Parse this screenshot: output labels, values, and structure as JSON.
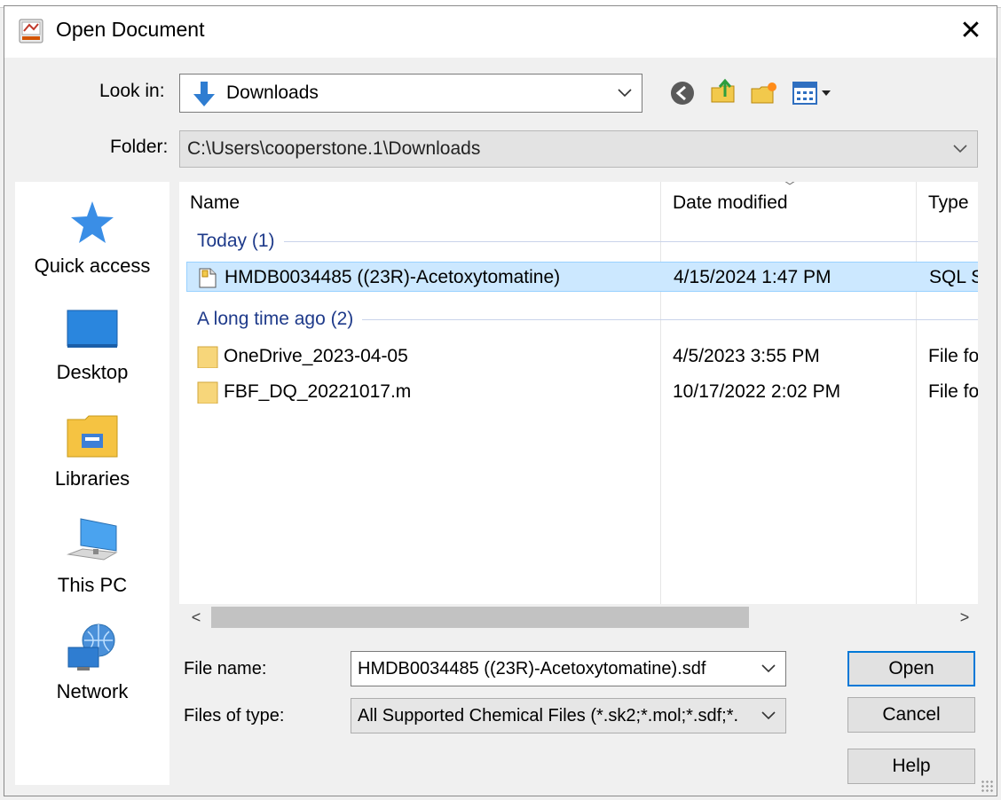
{
  "window": {
    "title": "Open Document",
    "close_glyph": "✕"
  },
  "look_in": {
    "label": "Look in:",
    "value": "Downloads",
    "icon": "download-arrow-icon"
  },
  "toolbar": {
    "icons": [
      "back-icon",
      "up-folder-icon",
      "new-folder-icon",
      "view-menu-icon"
    ]
  },
  "folder": {
    "label": "Folder:",
    "value": "C:\\Users\\cooperstone.1\\Downloads"
  },
  "places": [
    {
      "label": "Quick access",
      "icon": "star-icon"
    },
    {
      "label": "Desktop",
      "icon": "desktop-icon"
    },
    {
      "label": "Libraries",
      "icon": "libraries-icon"
    },
    {
      "label": "This PC",
      "icon": "computer-icon"
    },
    {
      "label": "Network",
      "icon": "network-icon"
    }
  ],
  "file_list": {
    "columns": [
      "Name",
      "Date modified",
      "Type"
    ],
    "sort_indicator": "﹀",
    "groups": [
      {
        "title": "Today (1)",
        "files": [
          {
            "name": "HMDB0034485 ((23R)-Acetoxytomatine)",
            "date": "4/15/2024 1:47 PM",
            "type": "SQL S",
            "icon": "document-icon",
            "selected": true
          }
        ]
      },
      {
        "title": "A long time ago (2)",
        "files": [
          {
            "name": "OneDrive_2023-04-05",
            "date": "4/5/2023 3:55 PM",
            "type": "File fo",
            "icon": "folder-icon",
            "selected": false
          },
          {
            "name": "FBF_DQ_20221017.m",
            "date": "10/17/2022 2:02 PM",
            "type": "File fo",
            "icon": "folder-icon",
            "selected": false
          }
        ]
      }
    ]
  },
  "scrollbar": {
    "left_arrow": "<",
    "right_arrow": ">"
  },
  "file_name": {
    "label": "File name:",
    "value": "HMDB0034485 ((23R)-Acetoxytomatine).sdf"
  },
  "file_type": {
    "label": "Files of type:",
    "value": "All Supported Chemical Files (*.sk2;*.mol;*.sdf;*."
  },
  "buttons": {
    "open": "Open",
    "cancel": "Cancel",
    "help": "Help"
  },
  "colors": {
    "accent": "#0078d7",
    "selection": "#cce8ff",
    "group_text": "#1e3a8a"
  }
}
